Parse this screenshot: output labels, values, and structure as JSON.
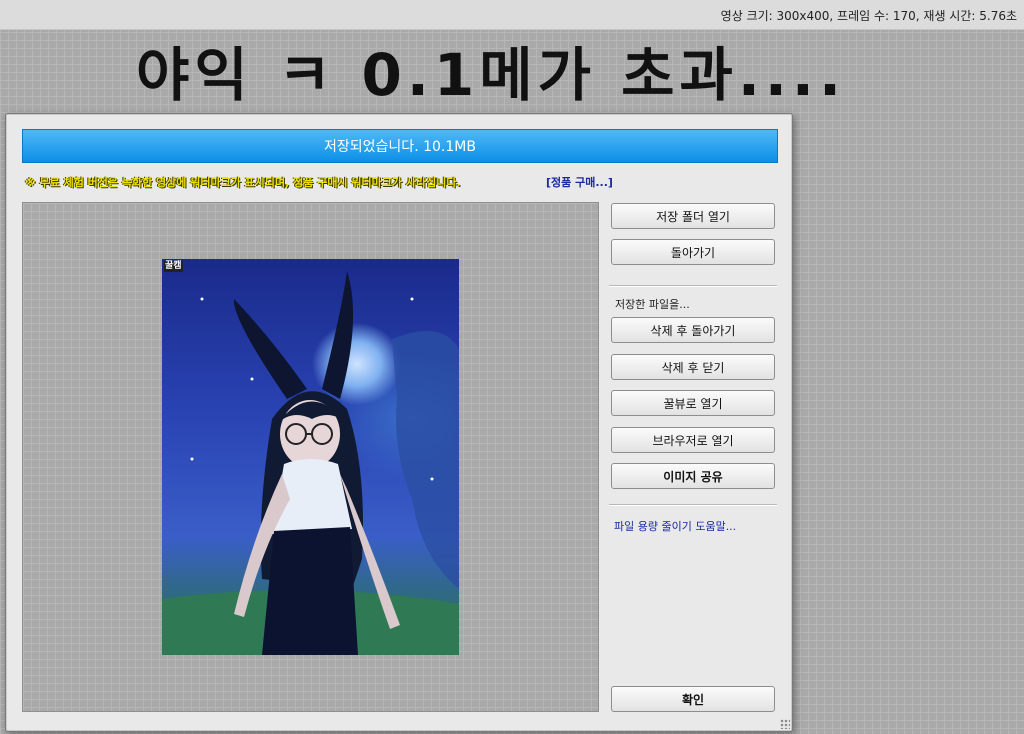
{
  "topbar": {
    "info": "영상 크기: 300x400, 프레임 수: 170, 재생 시간: 5.76초"
  },
  "caption": "야익 ㅋ 0.1메가 초과....",
  "dialog": {
    "banner": "저장되었습니다. 10.1MB",
    "notice": "※ 무료 체험 버전은 녹화한 영상에 워터마크가 표시되며, 정품 구매시 워터마크가 사라집니다.",
    "buy_link": "[정품 구매...]",
    "preview": {
      "stamp": "꿀캠"
    },
    "buttons": {
      "open_folder": "저장 폴더 열기",
      "back": "돌아가기",
      "saved_file_label": "저장한 파일을...",
      "delete_back": "삭제 후 돌아가기",
      "delete_close": "삭제 후 닫기",
      "open_honeyview": "꿀뷰로 열기",
      "open_browser": "브라우저로 열기",
      "share_image": "이미지 공유",
      "help_link": "파일 용량 줄이기 도움말...",
      "ok": "확인"
    }
  },
  "colors": {
    "banner": "#0c8fe6",
    "notice": "#f0e000",
    "link": "#1a2aa0"
  }
}
